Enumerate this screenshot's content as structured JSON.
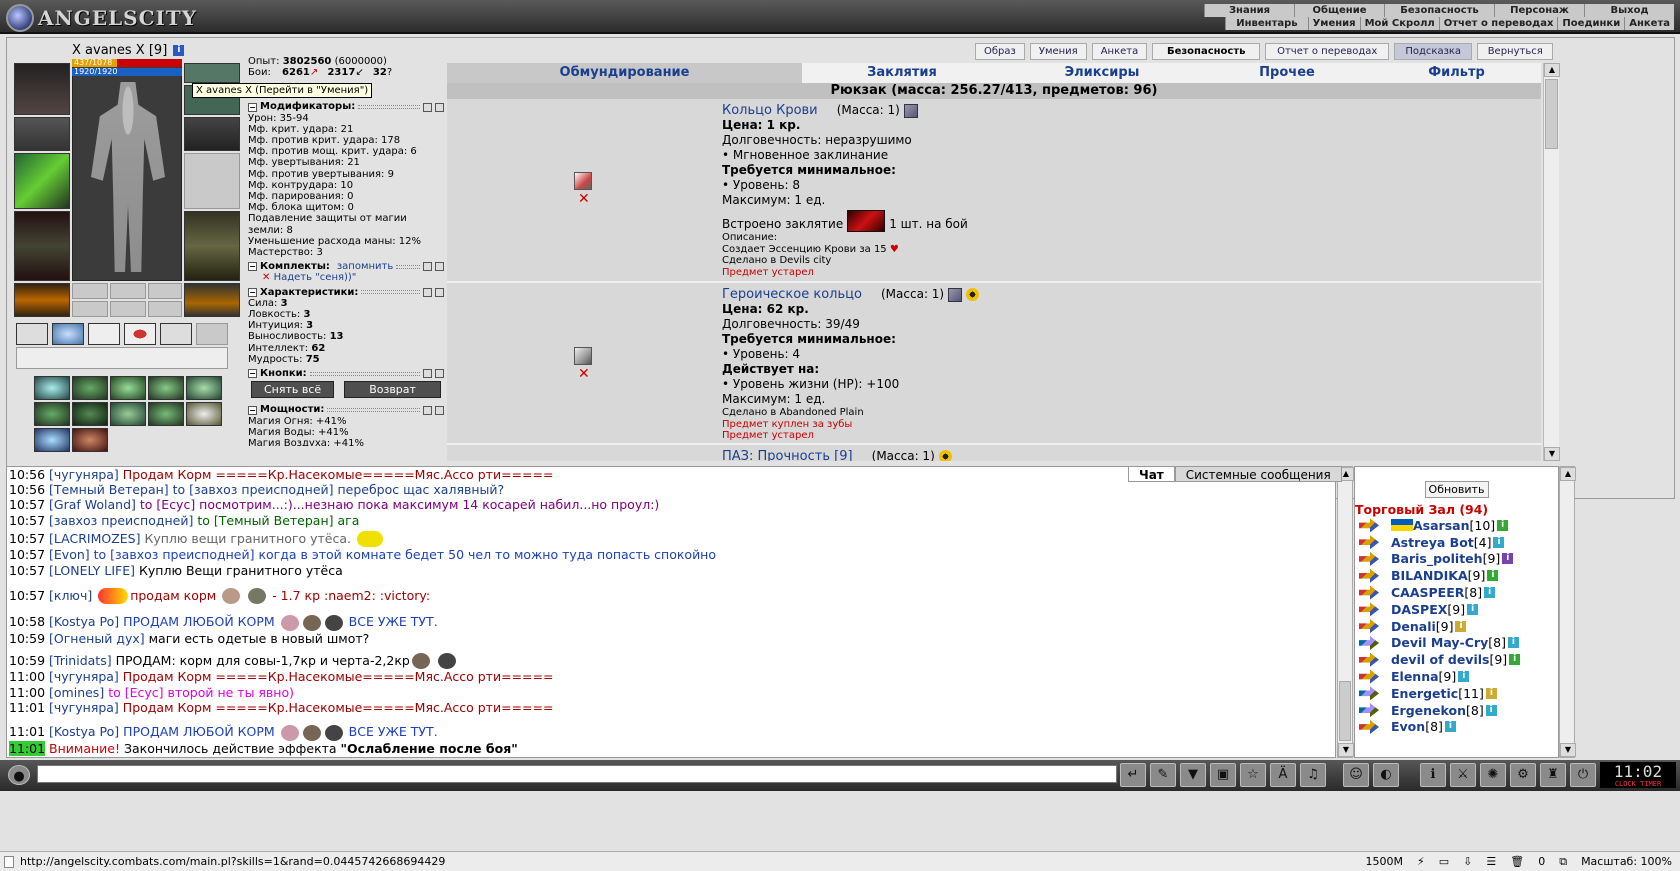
{
  "logo": "ANGELSCITY",
  "topnav": {
    "row1": [
      "Знания",
      "Общение",
      "Безопасность",
      "Персонаж",
      "Выход"
    ],
    "row2": [
      "Инвентарь",
      "Умения",
      "Мой Скролл",
      "Отчет о переводах",
      "Поединки",
      "Анкета"
    ]
  },
  "character": {
    "name": "X avanes X",
    "level": "[9]",
    "hp": "437/1078",
    "hp_fraction": 0.405,
    "mana": "1920/1920",
    "tooltip": "X avanes X (Перейти в \"Умения\")"
  },
  "stats": {
    "exp_label": "Опыт:",
    "exp_value": "3802560",
    "exp_next": "(6000000)",
    "battles_label": "Бои:",
    "battles_win": "6261",
    "battles_loss": "2317",
    "battles_draw": "32",
    "modifiers_title": "Модификаторы:",
    "modifiers": [
      "Урон: 35-94",
      "Мф. крит. удара: 21",
      "Мф. против крит. удара: 178",
      "Мф. против мощ. крит. удара: 6",
      "Мф. увертывания: 21",
      "Мф. против увертывания: 9",
      "Мф. контрудара: 10",
      "Мф. парирования: 0",
      "Мф. блока щитом: 0",
      "Подавление защиты от магии земли: 8",
      "Уменьшение расхода маны: 12%",
      "Мастерство: 3"
    ],
    "sets_title": "Комплекты:",
    "sets_remember": "запомнить",
    "sets_item": "Надеть \"сеня))\"",
    "chars_title": "Характеристики:",
    "chars": [
      {
        "label": "Сила:",
        "value": "3"
      },
      {
        "label": "Ловкость:",
        "value": "3"
      },
      {
        "label": "Интуиция:",
        "value": "3"
      },
      {
        "label": "Выносливость:",
        "value": "13"
      },
      {
        "label": "Интеллект:",
        "value": "62"
      },
      {
        "label": "Мудрость:",
        "value": "75"
      }
    ],
    "buttons_title": "Кнопки:",
    "btn_remove_all": "Снять всё",
    "btn_return": "Возврат",
    "power_title": "Мощности:",
    "powers": [
      "Магия Огня: +41%",
      "Магия Воды: +41%",
      "Магия Воздуха: +41%"
    ]
  },
  "tabs": [
    {
      "label": "Образ"
    },
    {
      "label": "Умения"
    },
    {
      "label": "Анкета"
    },
    {
      "label": "Безопасность"
    },
    {
      "label": "Отчет о переводах"
    },
    {
      "label": "Подсказка"
    },
    {
      "label": "Вернуться"
    }
  ],
  "inventory_tabs": [
    "Обмундирование",
    "Заклятия",
    "Эликсиры",
    "Прочее",
    "Фильтр"
  ],
  "backpack_label": "Рюкзак (масса: 256.27/413, предметов: 96)",
  "items": [
    {
      "name": "Кольцо Крови",
      "mass": "(Масса: 1)",
      "price": "Цена: 1 кр.",
      "durability": "Долговечность: неразрушимо",
      "bullet1": "• Мгновенное заклинание",
      "req_title": "Требуется минимальное:",
      "req": "• Уровень: 8",
      "max": "Максимум: 1 ед.",
      "spell_label": "Встроено заклятие",
      "spell_count": "1 шт. на бой",
      "desc_title": "Описание:",
      "desc": "Создает Эссенцию Крови за 15",
      "made": "Сделано в Devils city",
      "warn": "Предмет устарел"
    },
    {
      "name": "Героическое кольцо",
      "mass": "(Масса: 1)",
      "price": "Цена: 62 кр.",
      "durability": "Долговечность: 39/49",
      "req_title": "Требуется минимальное:",
      "req": "• Уровень: 4",
      "acts_title": "Действует на:",
      "acts": "• Уровень жизни (HP): +100",
      "max": "Максимум: 1 ед.",
      "made": "Сделано в Abandoned Plain",
      "warn1": "Предмет куплен за зубы",
      "warn2": "Предмет устарел"
    },
    {
      "name": "ПАЗ: Прочность [9]",
      "mass": "(Масса: 1)"
    }
  ],
  "chat_tabs": [
    "Чат",
    "Системные сообщения"
  ],
  "chat": [
    {
      "time": "10:56",
      "nick": "[чугуняра]",
      "text": "Продам Корм =====Кр.Насекомые=====Мяс.Ассо рти=====",
      "color": "#a00000"
    },
    {
      "time": "10:56",
      "nick": "[Темный Ветеран]",
      "text": "to [завхоз преисподней] переброс щас халявный?",
      "color": "#1b3f8f"
    },
    {
      "time": "10:57",
      "nick": "[Graf Woland]",
      "text": "to [Есус] посмотрим...:)...незнаю пока максимум 14 косарей набил...но проул:)",
      "color": "#800080"
    },
    {
      "time": "10:57",
      "nick": "[завхоз преисподней]",
      "text": "to [Темный Ветеран] ага",
      "color": "#006400"
    },
    {
      "time": "10:57",
      "nick": "[LACRIMOZES]",
      "text": "Куплю вещи гранитного утёса.",
      "color": "#666666"
    },
    {
      "time": "10:57",
      "nick": "[Evon]",
      "text": "to [завхоз преисподней] когда в этой комнате бедет 50 чел то можно туда попасть спокойно",
      "color": "#1b3fbf"
    },
    {
      "time": "10:57",
      "nick": "[LONELY LIFE]",
      "text": "Куплю Вещи гранитного утёса",
      "color": "#000000"
    },
    {
      "time": "10:57",
      "nick": "[ключ]",
      "text": "продам корм",
      "text2": "- 1.7 кр :naem2: :victory:",
      "color": "#a00000"
    },
    {
      "time": "10:58",
      "nick": "[Kostya Po]",
      "text": "ПРОДАМ ЛЮБОЙ КОРМ",
      "text2": "ВСЕ УЖЕ ТУТ.",
      "color": "#1b3fbf"
    },
    {
      "time": "10:59",
      "nick": "[Огненый дух]",
      "text": "маги есть одетые в новый шмот?",
      "color": "#000000"
    },
    {
      "time": "10:59",
      "nick": "[Trinidats]",
      "text": "ПРОДАМ: корм для совы-1,7кр и черта-2,2кр",
      "color": "#000000"
    },
    {
      "time": "11:00",
      "nick": "[чугуняра]",
      "text": "Продам Корм =====Кр.Насекомые=====Мяс.Ассо рти=====",
      "color": "#a00000"
    },
    {
      "time": "11:00",
      "nick": "[omines]",
      "text": "to [Есус] второй не ты явно)",
      "color": "#e000e0"
    },
    {
      "time": "11:01",
      "nick": "[чугуняра]",
      "text": "Продам Корм =====Кр.Насекомые=====Мяс.Ассо рти=====",
      "color": "#a00000"
    },
    {
      "time": "11:01",
      "nick": "[Kostya Po]",
      "text": "ПРОДАМ ЛЮБОЙ КОРМ",
      "text2": "ВСЕ УЖЕ ТУТ.",
      "color": "#1b3fbf"
    }
  ],
  "system_msg": {
    "time": "11:01",
    "warn": "Внимание!",
    "text": "Закончилось действие эффекта ",
    "effect": "\"Ослабление после боя\""
  },
  "users": {
    "refresh": "Обновить",
    "room": "Торговый Зал (94)",
    "list": [
      {
        "name": "Asarsan",
        "level": "[10]"
      },
      {
        "name": "Astreya Bot",
        "level": "[4]"
      },
      {
        "name": "Baris_politeh",
        "level": "[9]"
      },
      {
        "name": "BILANDIKA",
        "level": "[9]"
      },
      {
        "name": "CAASPEER",
        "level": "[8]"
      },
      {
        "name": "DASPEX",
        "level": "[9]"
      },
      {
        "name": "Denali",
        "level": "[9]"
      },
      {
        "name": "Devil May-Cry",
        "level": "[8]"
      },
      {
        "name": "devil of devils",
        "level": "[9]"
      },
      {
        "name": "Elenna",
        "level": "[9]"
      },
      {
        "name": "Energetic",
        "level": "[11]"
      },
      {
        "name": "Ergenekon",
        "level": "[8]"
      },
      {
        "name": "Evon",
        "level": "[8]"
      }
    ]
  },
  "clock": {
    "time": "11:02",
    "label": "CLOCK TIMER"
  },
  "statusbar": {
    "url": "http://angelscity.combats.com/main.pl?skills=1&rand=0.0445742668694429",
    "mem": "1500M",
    "count": "0",
    "zoom": "Масштаб: 100%"
  }
}
